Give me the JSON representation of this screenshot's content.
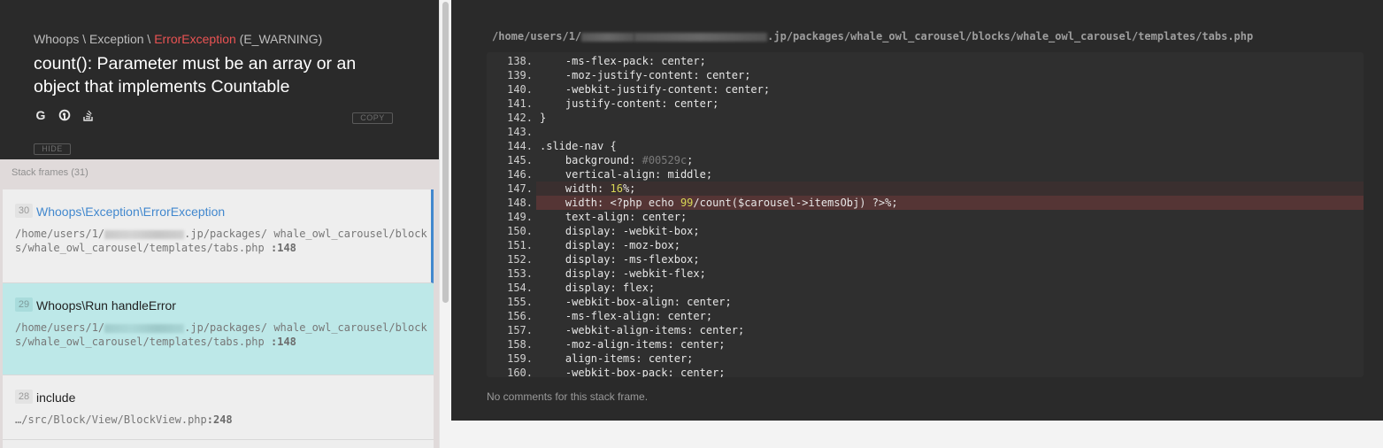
{
  "exception": {
    "prefix": "Whoops \\ Exception \\ ",
    "class": "ErrorException",
    "type": " (E_WARNING)",
    "message": "count(): Parameter must be an array or an object that implements Countable",
    "copy_label": "COPY",
    "hide_label": "HIDE"
  },
  "search_icons": [
    "google-icon",
    "duckduckgo-icon",
    "stackoverflow-icon"
  ],
  "stack": {
    "title": "Stack frames (31)",
    "frames": [
      {
        "index": "30",
        "class": "Whoops\\Exception\\ErrorException",
        "file_start": "/home/users/1/",
        "file_mid": ".jp/packages/",
        "file_rest": "whale_owl_carousel/blocks/whale_owl_carousel/templates/tabs.php",
        "line": ":148"
      },
      {
        "index": "29",
        "class": "Whoops\\Run handleError",
        "file_start": "/home/users/1/",
        "file_mid": ".jp/packages/",
        "file_rest": "whale_owl_carousel/blocks/whale_owl_carousel/templates/tabs.php",
        "line": ":148"
      },
      {
        "index": "28",
        "class": "include",
        "file_start": "…/src/Block/View/BlockView.php",
        "line": ":248"
      }
    ]
  },
  "code": {
    "path_start": "/home/users/1/",
    "path_rest": ".jp/packages/whale_owl_carousel/blocks/whale_owl_carousel/templates/tabs.php",
    "lines": [
      {
        "n": "138.",
        "t": "    -ms-flex-pack: center;"
      },
      {
        "n": "139.",
        "t": "    -moz-justify-content: center;"
      },
      {
        "n": "140.",
        "t": "    -webkit-justify-content: center;"
      },
      {
        "n": "141.",
        "t": "    justify-content: center;"
      },
      {
        "n": "142.",
        "t": "}"
      },
      {
        "n": "143.",
        "t": ""
      },
      {
        "n": "144.",
        "t": ".slide-nav {"
      },
      {
        "n": "145.",
        "t": "    background: ",
        "dim": "#00529c",
        "after": ";"
      },
      {
        "n": "146.",
        "t": "    vertical-align: middle;"
      },
      {
        "n": "147.",
        "t": "    width: ",
        "num": "16",
        "after": "%;",
        "hl": "hl1"
      },
      {
        "n": "148.",
        "t": "    width: <?php echo ",
        "num": "99",
        "after": "/count($carousel->itemsObj) ?>%;",
        "hl": "hl2"
      },
      {
        "n": "149.",
        "t": "    text-align: center;"
      },
      {
        "n": "150.",
        "t": "    display: -webkit-box;"
      },
      {
        "n": "151.",
        "t": "    display: -moz-box;"
      },
      {
        "n": "152.",
        "t": "    display: -ms-flexbox;"
      },
      {
        "n": "153.",
        "t": "    display: -webkit-flex;"
      },
      {
        "n": "154.",
        "t": "    display: flex;"
      },
      {
        "n": "155.",
        "t": "    -webkit-box-align: center;"
      },
      {
        "n": "156.",
        "t": "    -ms-flex-align: center;"
      },
      {
        "n": "157.",
        "t": "    -webkit-align-items: center;"
      },
      {
        "n": "158.",
        "t": "    -moz-align-items: center;"
      },
      {
        "n": "159.",
        "t": "    align-items: center;"
      },
      {
        "n": "160.",
        "t": "    -webkit-box-pack: center;"
      }
    ],
    "comments": "No comments for this stack frame."
  },
  "colors": {
    "accent": "#4288ce",
    "error": "#e95353",
    "active_frame": "#bde8e8",
    "header_bg": "#2a2a2a"
  }
}
